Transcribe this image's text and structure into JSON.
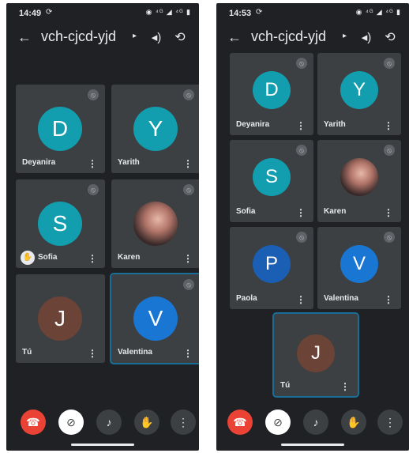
{
  "colors": {
    "background": "#1f2124",
    "tile": "#3c4043",
    "teal": "#129eaf",
    "blue_avatar": "#1976d2",
    "dark_blue_avatar": "#1a5fb4",
    "you_avatar": "#6b4337",
    "end_call": "#ea4335",
    "active_border": "#1a6f99"
  },
  "left": {
    "status": {
      "time": "14:49",
      "sync_icon": "sync-icon",
      "right_icons": "◉ ⁴ᴳ ◢ ⁴ᴳ ▮"
    },
    "meeting_code": "vch-cjcd-yjd",
    "participants": [
      {
        "name": "Deyanira",
        "initial": "D"
      },
      {
        "name": "Yarith",
        "initial": "Y"
      },
      {
        "name": "Sofia",
        "initial": "S"
      },
      {
        "name": "Karen",
        "initial": ""
      },
      {
        "name": "Tú",
        "initial": "J"
      },
      {
        "name": "Valentina",
        "initial": "V"
      }
    ]
  },
  "right": {
    "status": {
      "time": "14:53",
      "sync_icon": "sync-icon",
      "right_icons": "◉ ⁴ᴳ ◢ ⁴ᴳ ▮"
    },
    "meeting_code": "vch-cjcd-yjd",
    "participants": [
      {
        "name": "Deyanira",
        "initial": "D"
      },
      {
        "name": "Yarith",
        "initial": "Y"
      },
      {
        "name": "Sofia",
        "initial": "S"
      },
      {
        "name": "Karen",
        "initial": ""
      },
      {
        "name": "Paola",
        "initial": "P"
      },
      {
        "name": "Valentina",
        "initial": "V"
      },
      {
        "name": "Tú",
        "initial": "J"
      }
    ]
  },
  "icons": {
    "back": "←",
    "chevron": "▸",
    "speaker": "🔊",
    "switch_camera": "⟲",
    "mute": "🎙",
    "menu": "⋮",
    "end_call": "☎",
    "camera_off": "⊘",
    "mic": "🎤",
    "raise_hand": "✋",
    "more": "⋮",
    "hand_badge": "✋"
  }
}
